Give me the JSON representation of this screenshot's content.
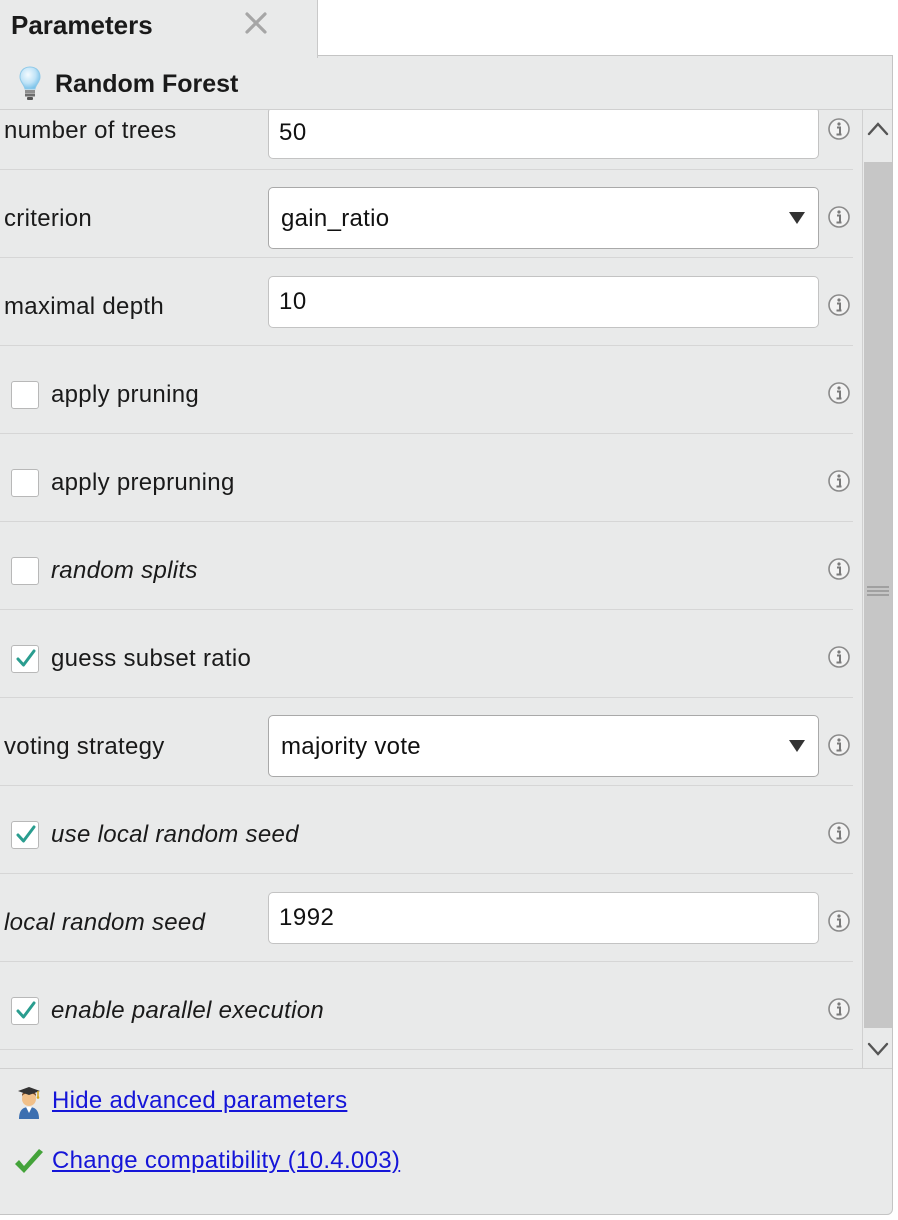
{
  "tab": {
    "title": "Parameters",
    "close_icon": "close-icon"
  },
  "operator": {
    "title": "Random Forest",
    "icon": "lightbulb-icon"
  },
  "parameters": {
    "number_of_trees": {
      "label": "number of trees",
      "value": "50"
    },
    "criterion": {
      "label": "criterion",
      "value": "gain_ratio"
    },
    "maximal_depth": {
      "label": "maximal depth",
      "value": "10"
    },
    "apply_pruning": {
      "label": "apply pruning",
      "checked": false
    },
    "apply_prepruning": {
      "label": "apply prepruning",
      "checked": false
    },
    "random_splits": {
      "label": "random splits",
      "checked": false
    },
    "guess_subset_ratio": {
      "label": "guess subset ratio",
      "checked": true
    },
    "voting_strategy": {
      "label": "voting strategy",
      "value": "majority vote"
    },
    "use_local_random_seed": {
      "label": "use local random seed",
      "checked": true
    },
    "local_random_seed": {
      "label": "local random seed",
      "value": "1992"
    },
    "enable_parallel_execution": {
      "label": "enable parallel execution",
      "checked": true
    }
  },
  "footer": {
    "advanced_link": "Hide advanced parameters",
    "compat_link": "Change compatibility (10.4.003)"
  },
  "colors": {
    "accent_check": "#2a9d8f",
    "link": "#1515d8",
    "panel_bg": "#e9eaea"
  }
}
